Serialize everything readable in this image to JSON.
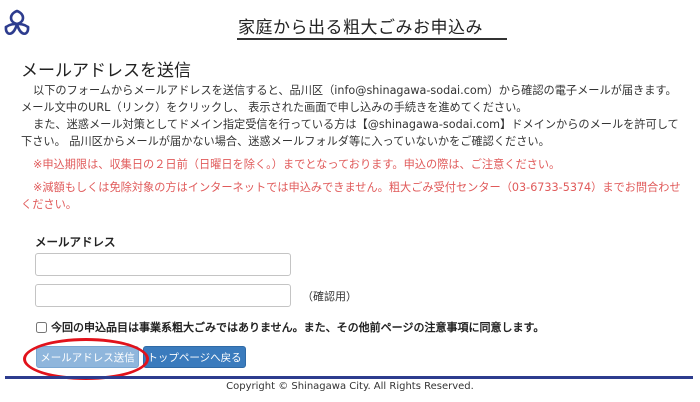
{
  "header": {
    "title": "家庭から出る粗大ごみお申込み",
    "logo_icon": "shinagawa-city-emblem",
    "brand_color": "#2d3c8e"
  },
  "section": {
    "title": "メールアドレスを送信"
  },
  "intro": {
    "p1_line1": "以下のフォームからメールアドレスを送信すると、品川区（info@shinagawa-sodai.com）から確認の電子メールが届きます。",
    "p1_line2": "メール文中のURL（リンク）をクリックし、 表示された画面で申し込みの手続きを進めてください。",
    "p2_line1": "また、迷惑メール対策としてドメイン指定受信を行っている方は【@shinagawa-sodai.com】ドメインからのメールを許可して",
    "p2_line2": "下さい。 品川区からメールが届かない場合、迷惑メールフォルダ等に入っていないかをご確認ください。"
  },
  "notes": {
    "accent_color": "#e05a5a",
    "n1": "※申込期限は、収集日の２日前（日曜日を除く。）までとなっております。申込の際は、ご注意ください。",
    "n2_line1": "※減額もしくは免除対象の方はインターネットでは申込みできません。粗大ごみ受付センター（03-6733-5374）までお問合わせ",
    "n2_line2": "ください。"
  },
  "form": {
    "email_label": "メールアドレス",
    "email_value": "",
    "email_confirm_value": "",
    "confirm_suffix": "（確認用）",
    "agree_text": "今回の申込品目は事業系粗大ごみではありません。また、その他前ページの注意事項に同意します。",
    "agree_checked": false
  },
  "buttons": {
    "send_label": "メールアドレス送信",
    "top_label": "トップページへ戻る"
  },
  "annotation_color": "#e1121b",
  "footer": {
    "copyright": "Copyright © Shinagawa City. All Rights Reserved."
  }
}
